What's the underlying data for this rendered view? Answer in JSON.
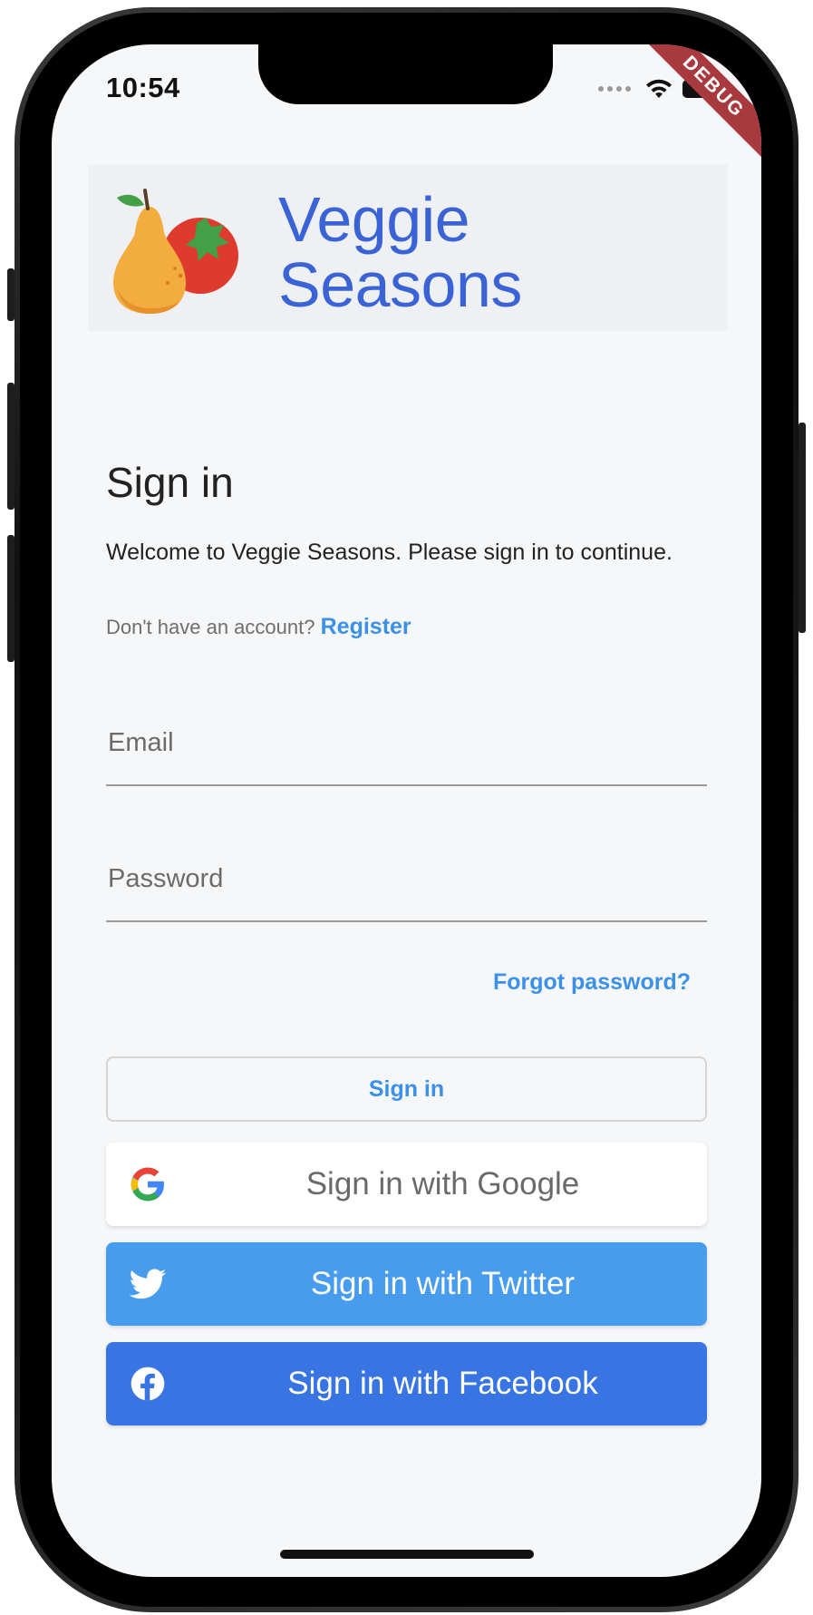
{
  "status_bar": {
    "time": "10:54",
    "debug_label": "DEBUG"
  },
  "logo": {
    "line1": "Veggie",
    "line2": "Seasons"
  },
  "signin": {
    "title": "Sign in",
    "welcome": "Welcome to Veggie Seasons. Please sign in to continue.",
    "no_account": "Don't have an account?",
    "register_label": "Register",
    "email_placeholder": "Email",
    "password_placeholder": "Password",
    "forgot_label": "Forgot password?",
    "signin_button": "Sign in",
    "google_button": "Sign in with Google",
    "twitter_button": "Sign in with Twitter",
    "facebook_button": "Sign in with Facebook"
  },
  "colors": {
    "accent": "#3b90e8",
    "logo_blue": "#3a64d6",
    "twitter": "#479cee",
    "facebook": "#3874e2",
    "debug_banner": "#a83a3f"
  },
  "icons": [
    "wifi-icon",
    "battery-icon",
    "pear-icon",
    "tomato-icon",
    "google-icon",
    "twitter-icon",
    "facebook-icon"
  ]
}
